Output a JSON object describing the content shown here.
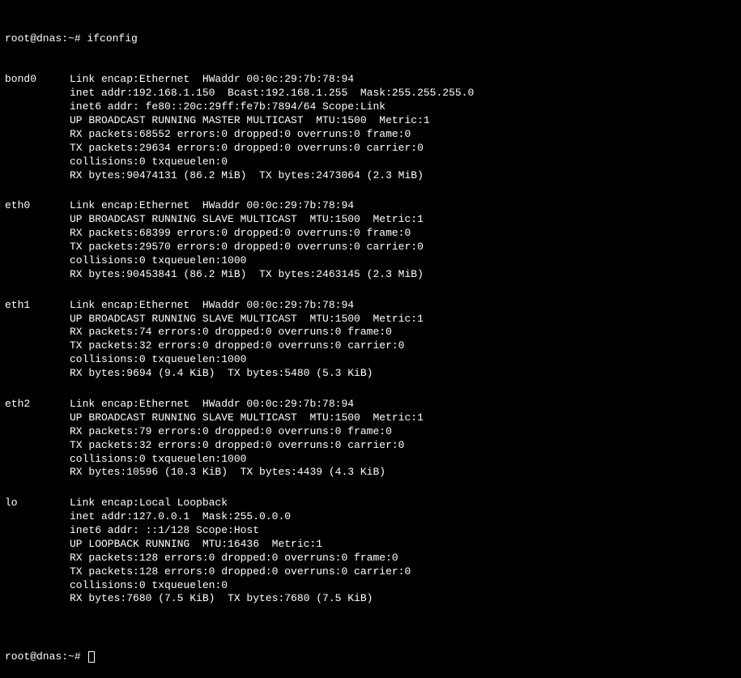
{
  "prompt1": "root@dnas:~# ",
  "command": "ifconfig",
  "prompt2": "root@dnas:~# ",
  "interfaces": [
    {
      "name": "bond0",
      "lines": [
        "Link encap:Ethernet  HWaddr 00:0c:29:7b:78:94",
        "inet addr:192.168.1.150  Bcast:192.168.1.255  Mask:255.255.255.0",
        "inet6 addr: fe80::20c:29ff:fe7b:7894/64 Scope:Link",
        "UP BROADCAST RUNNING MASTER MULTICAST  MTU:1500  Metric:1",
        "RX packets:68552 errors:0 dropped:0 overruns:0 frame:0",
        "TX packets:29634 errors:0 dropped:0 overruns:0 carrier:0",
        "collisions:0 txqueuelen:0",
        "RX bytes:90474131 (86.2 MiB)  TX bytes:2473064 (2.3 MiB)"
      ]
    },
    {
      "name": "eth0",
      "lines": [
        "Link encap:Ethernet  HWaddr 00:0c:29:7b:78:94",
        "UP BROADCAST RUNNING SLAVE MULTICAST  MTU:1500  Metric:1",
        "RX packets:68399 errors:0 dropped:0 overruns:0 frame:0",
        "TX packets:29570 errors:0 dropped:0 overruns:0 carrier:0",
        "collisions:0 txqueuelen:1000",
        "RX bytes:90453841 (86.2 MiB)  TX bytes:2463145 (2.3 MiB)"
      ]
    },
    {
      "name": "eth1",
      "lines": [
        "Link encap:Ethernet  HWaddr 00:0c:29:7b:78:94",
        "UP BROADCAST RUNNING SLAVE MULTICAST  MTU:1500  Metric:1",
        "RX packets:74 errors:0 dropped:0 overruns:0 frame:0",
        "TX packets:32 errors:0 dropped:0 overruns:0 carrier:0",
        "collisions:0 txqueuelen:1000",
        "RX bytes:9694 (9.4 KiB)  TX bytes:5480 (5.3 KiB)"
      ]
    },
    {
      "name": "eth2",
      "lines": [
        "Link encap:Ethernet  HWaddr 00:0c:29:7b:78:94",
        "UP BROADCAST RUNNING SLAVE MULTICAST  MTU:1500  Metric:1",
        "RX packets:79 errors:0 dropped:0 overruns:0 frame:0",
        "TX packets:32 errors:0 dropped:0 overruns:0 carrier:0",
        "collisions:0 txqueuelen:1000",
        "RX bytes:10596 (10.3 KiB)  TX bytes:4439 (4.3 KiB)"
      ]
    },
    {
      "name": "lo",
      "lines": [
        "Link encap:Local Loopback",
        "inet addr:127.0.0.1  Mask:255.0.0.0",
        "inet6 addr: ::1/128 Scope:Host",
        "UP LOOPBACK RUNNING  MTU:16436  Metric:1",
        "RX packets:128 errors:0 dropped:0 overruns:0 frame:0",
        "TX packets:128 errors:0 dropped:0 overruns:0 carrier:0",
        "collisions:0 txqueuelen:0",
        "RX bytes:7680 (7.5 KiB)  TX bytes:7680 (7.5 KiB)"
      ]
    }
  ]
}
